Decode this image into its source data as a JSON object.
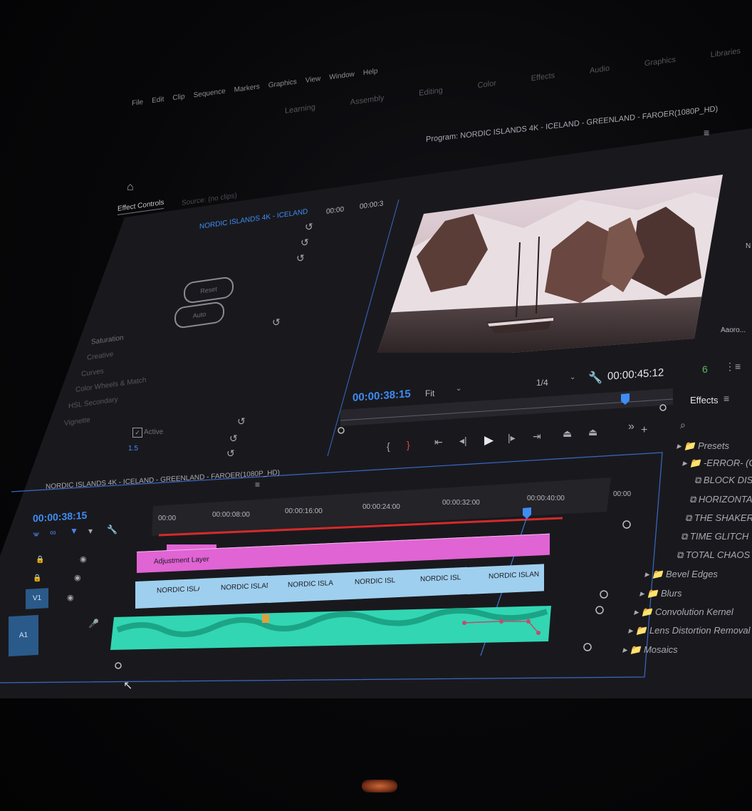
{
  "menu": {
    "items": [
      "File",
      "Edit",
      "Clip",
      "Sequence",
      "Markers",
      "Graphics",
      "View",
      "Window",
      "Help"
    ]
  },
  "workspaces": {
    "tabs": [
      "Learning",
      "Assembly",
      "Editing",
      "Color",
      "Effects",
      "Audio",
      "Graphics",
      "Libraries"
    ]
  },
  "program_monitor": {
    "title": "Program: NORDIC ISLANDS 4K - ICELAND - GREENLAND - FAROER(1080P_HD)",
    "current_tc": "00:00:38:15",
    "fit": "Fit",
    "resolution": "1/4",
    "duration_tc": "00:00:45:12"
  },
  "source_panel": {
    "tab_effect_controls": "Effect Controls",
    "tab_source": "Source: (no clips)",
    "clip_name": "NORDIC ISLANDS 4K - ICELAND",
    "mini_tc_start": "00:00",
    "mini_tc_end": "00:00:3",
    "btn_reset": "Reset",
    "btn_auto": "Auto",
    "active_label": "Active",
    "rows": [
      "Saturation",
      "Creative",
      "Curves",
      "Color Wheels & Match",
      "HSL Secondary",
      "Vignette"
    ],
    "value_a": "1.5"
  },
  "timeline": {
    "title": "NORDIC ISLANDS 4K - ICELAND - GREENLAND - FAROER(1080P_HD)",
    "current_tc": "00:00:38:15",
    "ruler": [
      "00:00",
      "00:00:08:00",
      "00:00:16:00",
      "00:00:24:00",
      "00:00:32:00",
      "00:00:40:00",
      "00:00"
    ],
    "clip_graphic": "Graphic",
    "clip_adjustment": "Adjustment Layer",
    "clips_v1": [
      "NORDIC ISLAN",
      "NORDIC ISLAN",
      "NORDIC ISLA",
      "NORDIC ISL",
      "NORDIC ISL",
      "NORDIC ISLAN"
    ],
    "track_v1": "V1",
    "track_a1": "A1"
  },
  "effects_panel": {
    "title": "Effects",
    "items": [
      {
        "label": "Presets",
        "indent": 0,
        "folder": true
      },
      {
        "label": "-ERROR- (G",
        "indent": 1,
        "folder": true
      },
      {
        "label": "BLOCK DIS",
        "indent": 2,
        "folder": false
      },
      {
        "label": "HORIZONTA",
        "indent": 2,
        "folder": false
      },
      {
        "label": "THE SHAKER",
        "indent": 2,
        "folder": false
      },
      {
        "label": "TIME GLITCH",
        "indent": 2,
        "folder": false
      },
      {
        "label": "TOTAL CHAOS",
        "indent": 2,
        "folder": false
      },
      {
        "label": "Bevel Edges",
        "indent": 1,
        "folder": true
      },
      {
        "label": "Blurs",
        "indent": 1,
        "folder": true
      },
      {
        "label": "Convolution Kernel",
        "indent": 1,
        "folder": true
      },
      {
        "label": "Lens Distortion Removal",
        "indent": 1,
        "folder": true
      },
      {
        "label": "Mosaics",
        "indent": 1,
        "folder": true
      }
    ]
  },
  "right_stub": {
    "label": "Aaoro...",
    "letter": "N"
  },
  "colors": {
    "accent": "#3f8cf5",
    "graphic_clip": "#e064d4",
    "video_clip": "#9fcfee",
    "audio_clip": "#32d6b3",
    "playhead_red": "#d22b2b"
  }
}
